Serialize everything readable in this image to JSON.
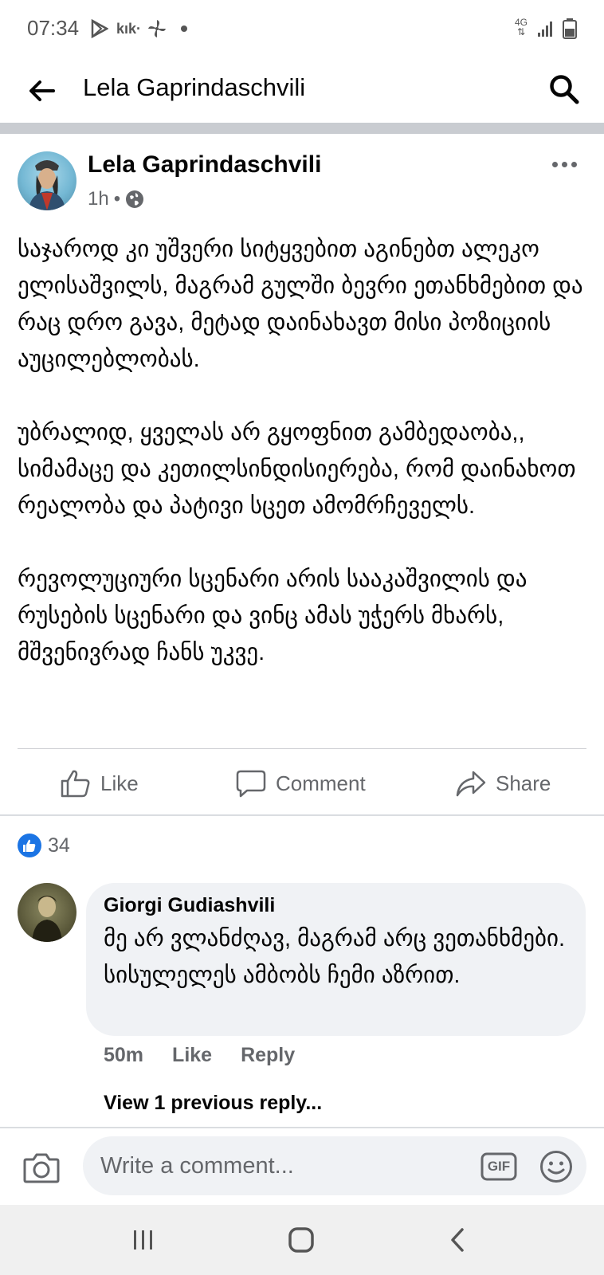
{
  "status_bar": {
    "time": "07:34",
    "icons": [
      "play-store-icon",
      "kik-icon",
      "pinwheel-icon",
      "notification-dot-icon",
      "4g-data-icon",
      "signal-icon",
      "battery-icon"
    ],
    "network": "4G"
  },
  "header": {
    "back_icon": "arrow-left-icon",
    "title": "Lela Gaprindaschvili",
    "search_icon": "search-icon"
  },
  "post": {
    "author": "Lela Gaprindaschvili",
    "time": "1h",
    "separator": "•",
    "privacy_icon": "globe-icon",
    "more_icon": "more-horizontal-icon",
    "paragraphs": [
      "საჯაროდ კი უშვერი სიტყვებით აგინებთ ალეკო ელისაშვილს, მაგრამ გულში ბევრი ეთანხმებით და რაც დრო გავა, მეტად დაინახავთ მისი პოზიციის აუცილებლობას.",
      "უბრალიდ, ყველას არ გყოფნით გამბედაობა,, სიმამაცე და კეთილსინდისიერება, რომ დაინახოთ რეალობა და პატივი სცეთ ამომრჩეველს.",
      "რევოლუციური სცენარი არის სააკაშვილის და რუსების სცენარი და ვინც ამას უჭერს მხარს, მშვენივრად ჩანს უკვე."
    ],
    "actions": {
      "like": "Like",
      "comment": "Comment",
      "share": "Share"
    },
    "reactions": {
      "icon": "like-badge-icon",
      "count": "34",
      "color": "#1b74e4"
    }
  },
  "comment": {
    "author": "Giorgi Gudiashvili",
    "text": "მე არ ვლანძღავ, მაგრამ არც ვეთანხმები. სისულელეს ამბობს ჩემი აზრით.",
    "time": "50m",
    "like": "Like",
    "reply": "Reply",
    "view_replies": "View 1 previous reply..."
  },
  "composer": {
    "camera_icon": "camera-icon",
    "placeholder": "Write a comment...",
    "gif_label": "GIF",
    "emoji_icon": "smiley-icon"
  },
  "nav_bar": {
    "buttons": [
      "recent-apps-icon",
      "home-icon",
      "back-icon"
    ]
  },
  "colors": {
    "text_primary": "#050505",
    "text_secondary": "#65676b",
    "bubble_bg": "#f0f2f5",
    "divider": "#c9ccd1",
    "accent": "#1b74e4"
  }
}
